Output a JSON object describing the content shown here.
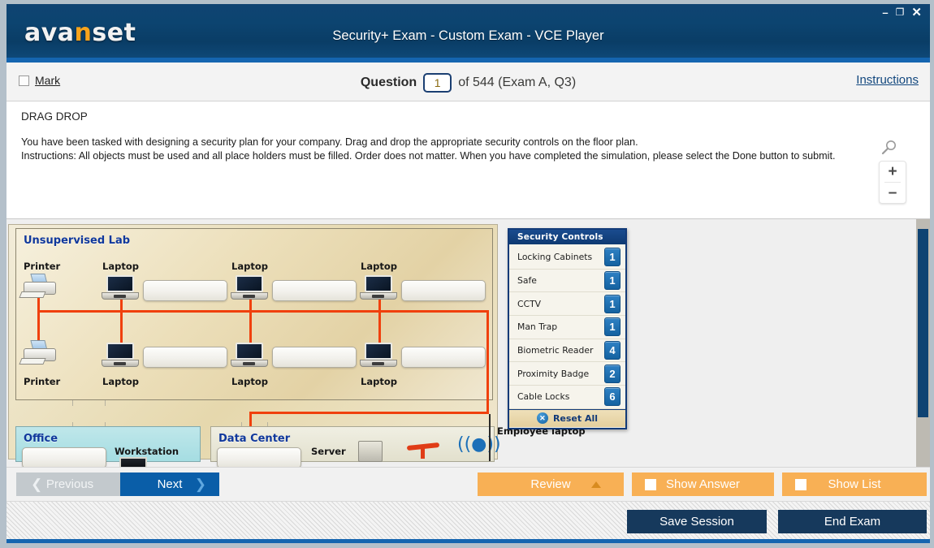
{
  "window": {
    "brand": "avanset",
    "brand_highlight_letter": "n",
    "title": "Security+ Exam - Custom Exam - VCE Player",
    "controls": {
      "minimize": "–",
      "maximize": "❐",
      "close": "✕"
    },
    "chrome_color": "#0c4470",
    "accent_color": "#1565b0"
  },
  "question_bar": {
    "mark_label": "Mark",
    "question_label": "Question",
    "question_number": "1",
    "of_text": "of 544 (Exam A, Q3)",
    "instructions_link": "Instructions"
  },
  "prompt": {
    "type_label": "DRAG DROP",
    "line1": "You have been tasked with designing a security plan for your company. Drag and drop the appropriate security controls on the floor plan.",
    "line2": "Instructions: All objects must be used and all place holders must be filled. Order does not matter. When you have completed the simulation, please select the Done button to submit.",
    "zoom_in": "+",
    "zoom_out": "–",
    "magnifier_icon": "magnifier-icon"
  },
  "simulation": {
    "zones": [
      {
        "name": "Unsupervised Lab"
      },
      {
        "name": "Office"
      },
      {
        "name": "Data Center"
      }
    ],
    "lab_devices_top": [
      "Printer",
      "Laptop",
      "Laptop",
      "Laptop"
    ],
    "lab_devices_bottom": [
      "Printer",
      "Laptop",
      "Laptop",
      "Laptop"
    ],
    "office_device": "Workstation",
    "datacenter_device": "Server",
    "employee_label": "Employee laptop",
    "security_controls": {
      "title": "Security Controls",
      "items": [
        {
          "name": "Locking Cabinets",
          "count": "1"
        },
        {
          "name": "Safe",
          "count": "1"
        },
        {
          "name": "CCTV",
          "count": "1"
        },
        {
          "name": "Man Trap",
          "count": "1"
        },
        {
          "name": "Biometric Reader",
          "count": "4"
        },
        {
          "name": "Proximity Badge",
          "count": "2"
        },
        {
          "name": "Cable Locks",
          "count": "6"
        }
      ],
      "reset_label": "Reset  All",
      "reset_icon": "close-circle-icon",
      "badge_color": "#1462a0",
      "header_color": "#0e3a72"
    }
  },
  "nav": {
    "previous": "Previous",
    "next": "Next",
    "review": "Review",
    "show_answer": "Show Answer",
    "show_list": "Show List",
    "prev_icon": "chevron-left-icon",
    "next_icon": "chevron-right-icon",
    "review_icon": "triangle-up-icon",
    "orange_color": "#f8b055",
    "next_color": "#0a5ea8"
  },
  "footer": {
    "save_session": "Save Session",
    "end_exam": "End Exam",
    "button_color": "#16395c"
  }
}
